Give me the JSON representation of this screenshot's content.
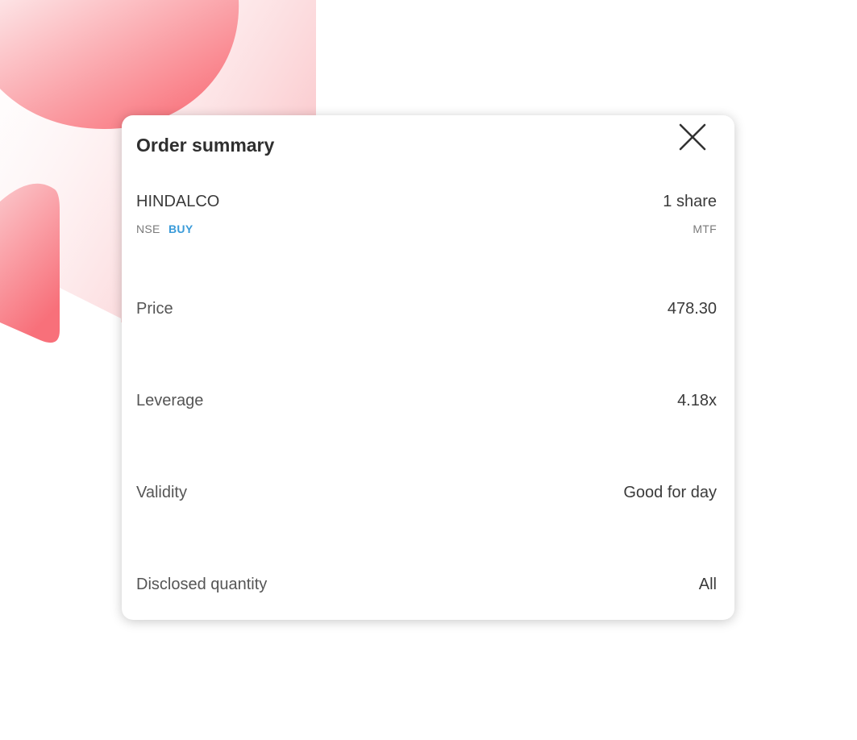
{
  "order_summary": {
    "title": "Order summary",
    "close_icon": "close-icon",
    "instrument": {
      "symbol": "HINDALCO",
      "exchange": "NSE",
      "side": "BUY",
      "quantity": "1 share",
      "product": "MTF"
    },
    "rows": [
      {
        "label": "Price",
        "value": "478.30"
      },
      {
        "label": "Leverage",
        "value": "4.18x"
      },
      {
        "label": "Validity",
        "value": "Good for day"
      },
      {
        "label": "Disclosed quantity",
        "value": "All"
      }
    ]
  },
  "colors": {
    "buy": "#3a9bd9",
    "accent_red": "#f8626c",
    "title_text": "#2f2f2f",
    "muted_text": "#7a7a7a"
  }
}
